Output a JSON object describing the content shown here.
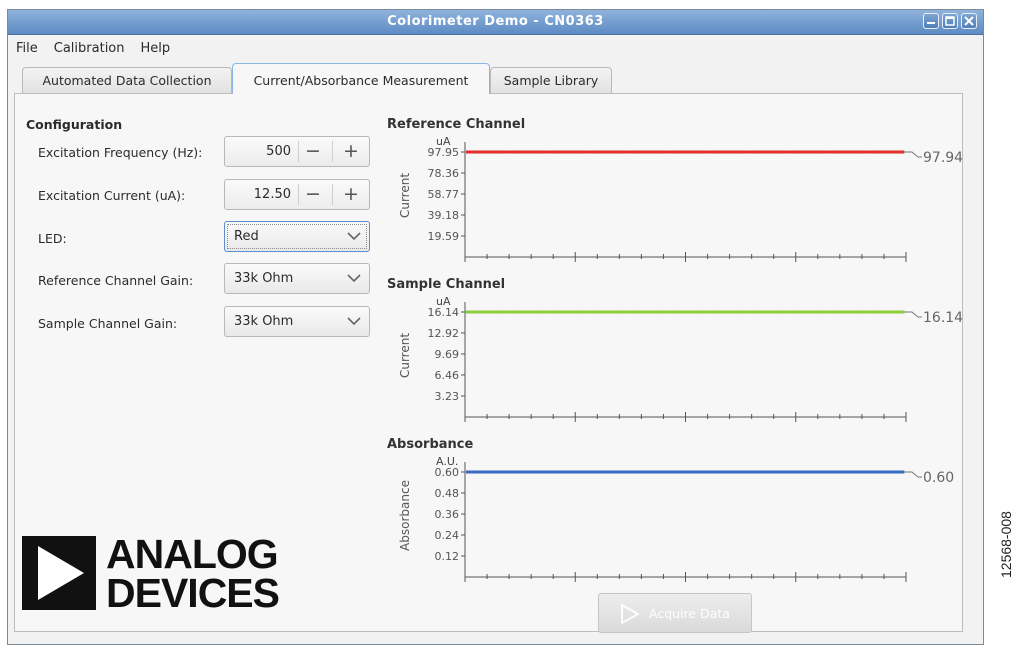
{
  "window": {
    "title": "Colorimeter Demo - CN0363"
  },
  "menu": [
    "File",
    "Calibration",
    "Help"
  ],
  "tabs": [
    "Automated Data Collection",
    "Current/Absorbance Measurement",
    "Sample Library"
  ],
  "active_tab": 1,
  "config": {
    "heading": "Configuration",
    "excitation_frequency": {
      "label": "Excitation Frequency (Hz):",
      "value": "500"
    },
    "excitation_current": {
      "label": "Excitation Current (uA):",
      "value": "12.50"
    },
    "led": {
      "label": "LED:",
      "value": "Red"
    },
    "reference_gain": {
      "label": "Reference Channel Gain:",
      "value": "33k Ohm"
    },
    "sample_gain": {
      "label": "Sample Channel Gain:",
      "value": "33k Ohm"
    }
  },
  "logo": {
    "line1": "ANALOG",
    "line2": "DEVICES"
  },
  "acquire_button": "Acquire Data",
  "figure_id": "12568-008",
  "icons": {
    "minimize": "minimize-icon",
    "maximize": "maximize-icon",
    "close": "close-icon",
    "spin_minus": "minus-icon",
    "spin_plus": "plus-icon",
    "dropdown": "chevron-down-icon",
    "play": "play-icon"
  },
  "chart_data": [
    {
      "type": "line",
      "title": "Reference Channel",
      "unit": "uA",
      "ylabel": "Current",
      "yticks": [
        "97.95",
        "78.36",
        "58.77",
        "39.18",
        "19.59"
      ],
      "ytick_values": [
        97.95,
        78.36,
        58.77,
        39.18,
        19.59
      ],
      "ylim": [
        0,
        97.95
      ],
      "series": [
        {
          "color": "#e0302e",
          "values": [
            97.94
          ]
        }
      ],
      "current_value": "97.94",
      "grid": false
    },
    {
      "type": "line",
      "title": "Sample Channel",
      "unit": "uA",
      "ylabel": "Current",
      "yticks": [
        "16.14",
        "12.92",
        "9.69",
        "6.46",
        "3.23"
      ],
      "ytick_values": [
        16.14,
        12.92,
        9.69,
        6.46,
        3.23
      ],
      "ylim": [
        0,
        16.14
      ],
      "series": [
        {
          "color": "#8ccf3a",
          "values": [
            16.14
          ]
        }
      ],
      "current_value": "16.14",
      "grid": false
    },
    {
      "type": "line",
      "title": "Absorbance",
      "unit": "A.U.",
      "ylabel": "Absorbance",
      "yticks": [
        "0.60",
        "0.48",
        "0.36",
        "0.24",
        "0.12"
      ],
      "ytick_values": [
        0.6,
        0.48,
        0.36,
        0.24,
        0.12
      ],
      "ylim": [
        0,
        0.6
      ],
      "series": [
        {
          "color": "#3a6cc6",
          "values": [
            0.6
          ]
        }
      ],
      "current_value": "0.60",
      "grid": false
    }
  ]
}
